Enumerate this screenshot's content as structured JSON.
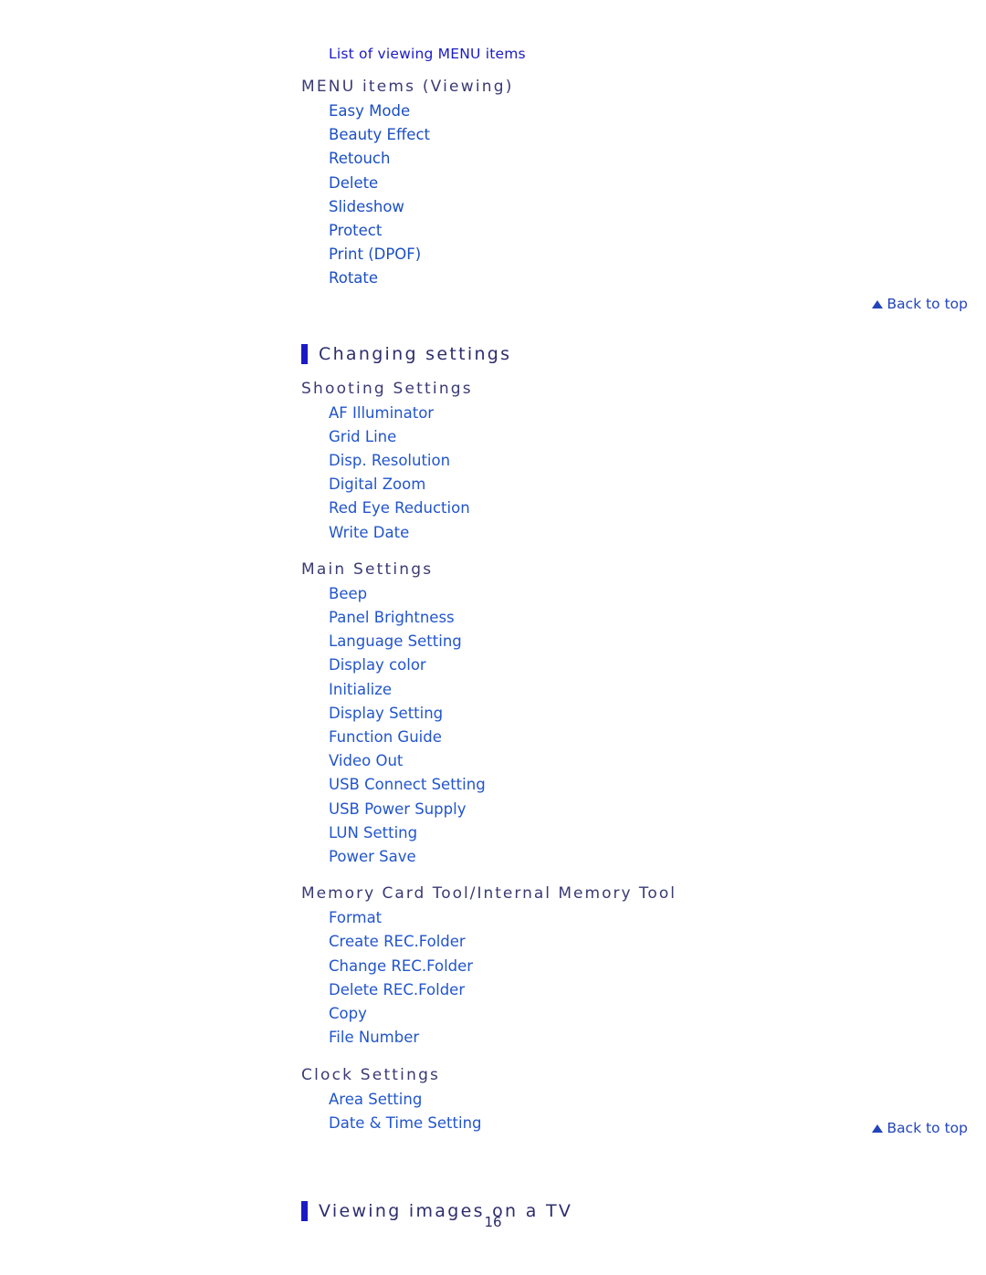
{
  "page": {
    "number": "16"
  },
  "top_link": {
    "label": "List of viewing MENU items"
  },
  "sections": [
    {
      "heading": "MENU items (Viewing)",
      "items": [
        "Easy Mode",
        "Beauty Effect",
        "Retouch",
        "Delete",
        "Slideshow",
        "Protect",
        "Print (DPOF)",
        "Rotate"
      ]
    }
  ],
  "back_to_top_1": {
    "label": "Back to top"
  },
  "changing_settings": {
    "title": "Changing settings",
    "groups": [
      {
        "heading": "Shooting Settings",
        "items": [
          "AF Illuminator",
          "Grid Line",
          "Disp. Resolution",
          "Digital Zoom",
          "Red Eye Reduction",
          "Write Date"
        ]
      },
      {
        "heading": "Main Settings",
        "items": [
          "Beep",
          "Panel Brightness",
          "Language Setting",
          "Display color",
          "Initialize",
          "Display Setting",
          "Function Guide",
          "Video Out",
          "USB Connect Setting",
          "USB Power Supply",
          "LUN Setting",
          "Power Save"
        ]
      },
      {
        "heading": "Memory Card Tool/Internal Memory Tool",
        "items": [
          "Format",
          "Create REC.Folder",
          "Change REC.Folder",
          "Delete REC.Folder",
          "Copy",
          "File Number"
        ]
      },
      {
        "heading": "Clock Settings",
        "items": [
          "Area Setting",
          "Date & Time Setting"
        ]
      }
    ]
  },
  "back_to_top_2": {
    "label": "Back to top"
  },
  "viewing_on_tv": {
    "title": "Viewing images on a TV"
  }
}
